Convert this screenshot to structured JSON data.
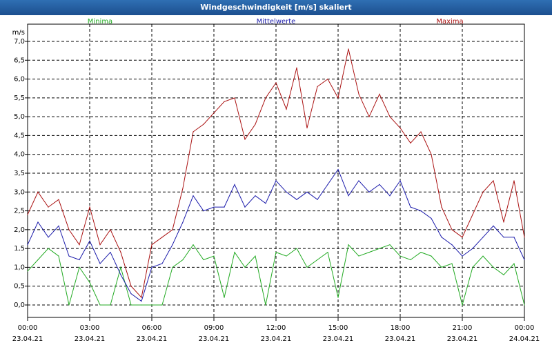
{
  "window": {
    "title": "Windgeschwindigkeit [m/s] skaliert"
  },
  "chart_data": {
    "type": "line",
    "title": "Windgeschwindigkeit [m/s] skaliert",
    "ylabel": "m/s",
    "xlabel": "",
    "ylim": [
      0,
      7
    ],
    "y_ticks": [
      0,
      0.5,
      1,
      1.5,
      2,
      2.5,
      3,
      3.5,
      4,
      4.5,
      5,
      5.5,
      6,
      6.5,
      7
    ],
    "y_tick_labels": [
      "0,0",
      "0,5",
      "1,0",
      "1,5",
      "2,0",
      "2,5",
      "3,0",
      "3,5",
      "4,0",
      "4,5",
      "5,0",
      "5,5",
      "6,0",
      "6,5",
      "7,0"
    ],
    "x_ticks": [
      {
        "time": "00:00",
        "date": "23.04.21"
      },
      {
        "time": "03:00",
        "date": "23.04.21"
      },
      {
        "time": "06:00",
        "date": "23.04.21"
      },
      {
        "time": "09:00",
        "date": "23.04.21"
      },
      {
        "time": "12:00",
        "date": "23.04.21"
      },
      {
        "time": "15:00",
        "date": "23.04.21"
      },
      {
        "time": "18:00",
        "date": "23.04.21"
      },
      {
        "time": "21:00",
        "date": "23.04.21"
      },
      {
        "time": "00:00",
        "date": "24.04.21"
      }
    ],
    "grid": true,
    "series": [
      {
        "name": "Minima",
        "color": "#22aa22",
        "x_hours": [
          0,
          0.5,
          1,
          1.5,
          2,
          2.5,
          3,
          3.5,
          4,
          4.5,
          5,
          5.5,
          6,
          6.5,
          7,
          7.5,
          8,
          8.5,
          9,
          9.5,
          10,
          10.5,
          11,
          11.5,
          12,
          12.5,
          13,
          13.5,
          14,
          14.5,
          15,
          15.5,
          16,
          16.5,
          17,
          17.5,
          18,
          18.5,
          19,
          19.5,
          20,
          20.5,
          21,
          21.5,
          22,
          22.5,
          23,
          23.5,
          24
        ],
        "values": [
          0.9,
          1.2,
          1.5,
          1.3,
          0.0,
          1.0,
          0.6,
          0.0,
          0.0,
          1.0,
          0.0,
          0.0,
          0.0,
          0.0,
          1.0,
          1.2,
          1.6,
          1.2,
          1.3,
          0.2,
          1.4,
          1.0,
          1.3,
          0.0,
          1.4,
          1.3,
          1.5,
          1.0,
          1.2,
          1.4,
          0.2,
          1.6,
          1.3,
          1.4,
          1.5,
          1.6,
          1.3,
          1.2,
          1.4,
          1.3,
          1.0,
          1.1,
          0.0,
          1.0,
          1.3,
          1.0,
          0.8,
          1.1,
          0.0
        ]
      },
      {
        "name": "Mittelwerte",
        "color": "#1a1aaa",
        "x_hours": [
          0,
          0.5,
          1,
          1.5,
          2,
          2.5,
          3,
          3.5,
          4,
          4.5,
          5,
          5.5,
          6,
          6.5,
          7,
          7.5,
          8,
          8.5,
          9,
          9.5,
          10,
          10.5,
          11,
          11.5,
          12,
          12.5,
          13,
          13.5,
          14,
          14.5,
          15,
          15.5,
          16,
          16.5,
          17,
          17.5,
          18,
          18.5,
          19,
          19.5,
          20,
          20.5,
          21,
          21.5,
          22,
          22.5,
          23,
          23.5,
          24
        ],
        "values": [
          1.6,
          2.2,
          1.8,
          2.1,
          1.3,
          1.2,
          1.7,
          1.1,
          1.4,
          0.8,
          0.3,
          0.1,
          1.0,
          1.1,
          1.6,
          2.2,
          2.9,
          2.5,
          2.6,
          2.6,
          3.2,
          2.6,
          2.9,
          2.7,
          3.3,
          3.0,
          2.8,
          3.0,
          2.8,
          3.2,
          3.6,
          2.9,
          3.3,
          3.0,
          3.2,
          2.9,
          3.3,
          2.6,
          2.5,
          2.3,
          1.8,
          1.6,
          1.3,
          1.5,
          1.8,
          2.1,
          1.8,
          1.8,
          1.2
        ]
      },
      {
        "name": "Maxima",
        "color": "#aa1111",
        "x_hours": [
          0,
          0.5,
          1,
          1.5,
          2,
          2.5,
          3,
          3.5,
          4,
          4.5,
          5,
          5.5,
          6,
          6.5,
          7,
          7.5,
          8,
          8.5,
          9,
          9.5,
          10,
          10.5,
          11,
          11.5,
          12,
          12.5,
          13,
          13.5,
          14,
          14.5,
          15,
          15.5,
          16,
          16.5,
          17,
          17.5,
          18,
          18.5,
          19,
          19.5,
          20,
          20.5,
          21,
          21.5,
          22,
          22.5,
          23,
          23.5,
          24
        ],
        "values": [
          2.4,
          3.0,
          2.6,
          2.8,
          2.0,
          1.6,
          2.6,
          1.6,
          2.0,
          1.4,
          0.5,
          0.2,
          1.6,
          1.8,
          2.0,
          3.1,
          4.6,
          4.8,
          5.1,
          5.4,
          5.5,
          4.4,
          4.8,
          5.5,
          5.9,
          5.2,
          6.3,
          4.7,
          5.8,
          6.0,
          5.5,
          6.8,
          5.6,
          5.0,
          5.6,
          5.0,
          4.7,
          4.3,
          4.6,
          4.0,
          2.6,
          2.0,
          1.8,
          2.4,
          3.0,
          3.3,
          2.2,
          3.3,
          1.8
        ]
      }
    ]
  }
}
